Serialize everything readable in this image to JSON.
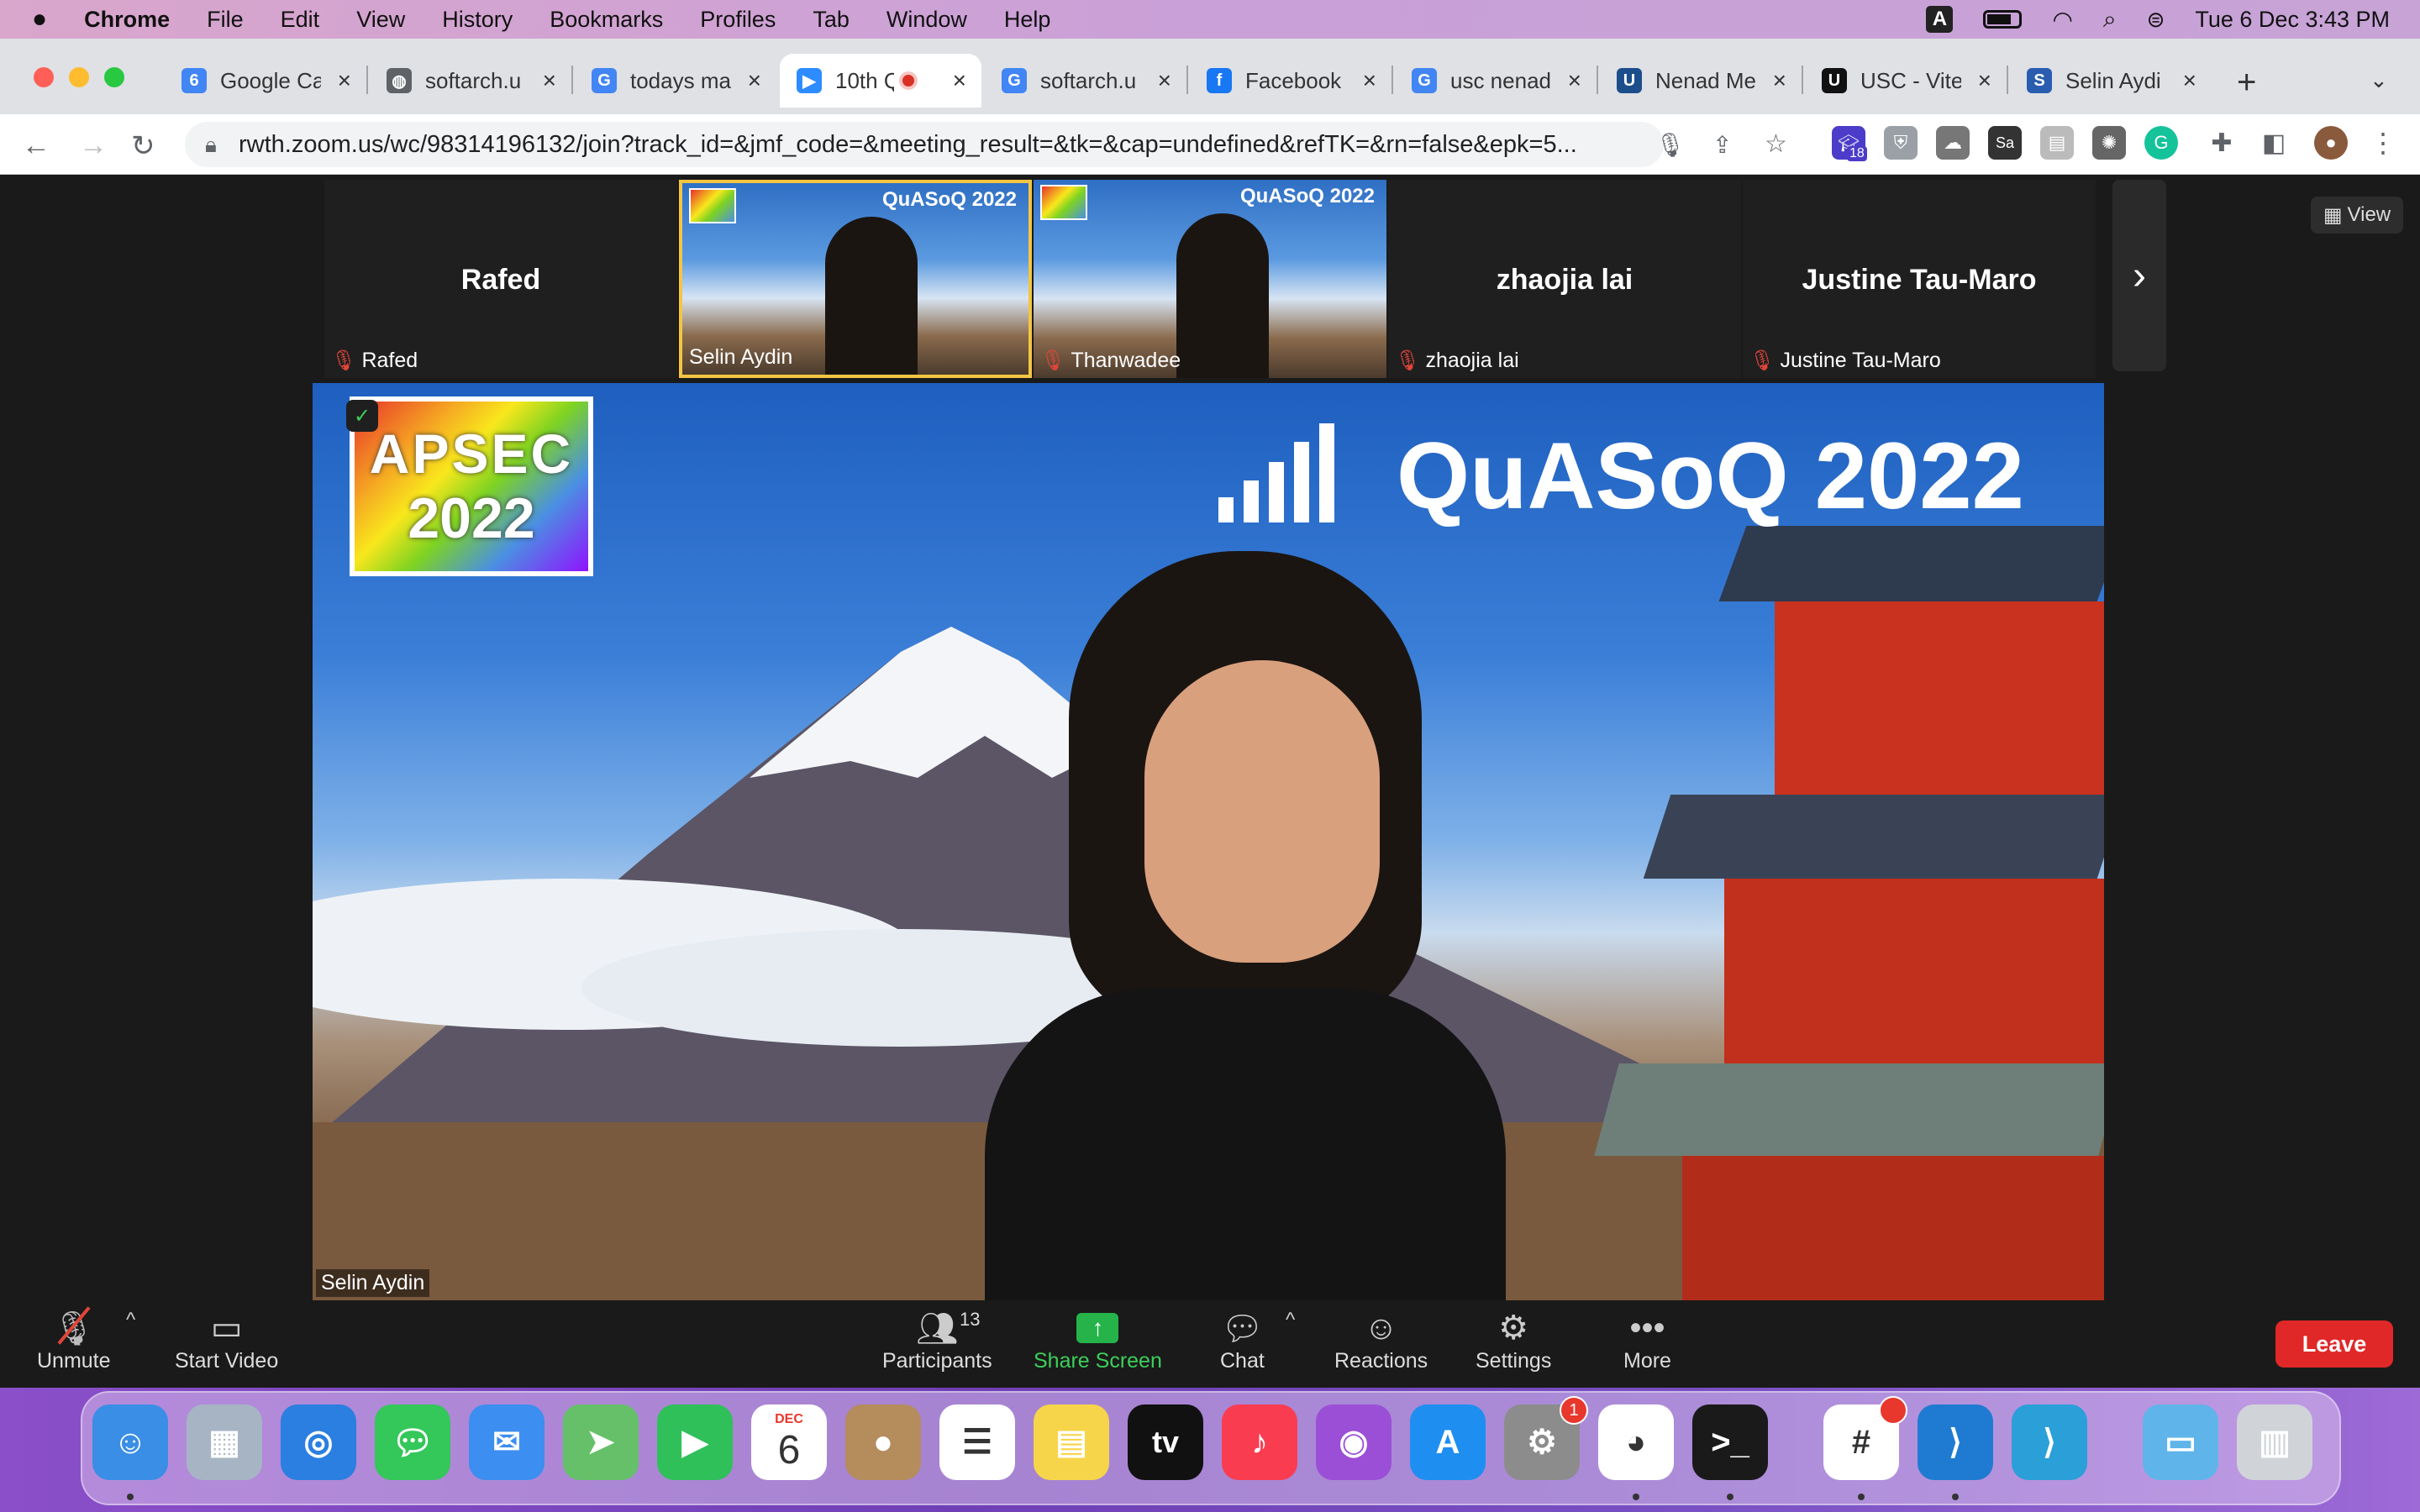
{
  "menubar": {
    "apple_icon": "apple-icon",
    "app": "Chrome",
    "items": [
      "File",
      "Edit",
      "View",
      "History",
      "Bookmarks",
      "Profiles",
      "Tab",
      "Window",
      "Help"
    ],
    "input_source": "A",
    "datetime": "Tue 6 Dec  3:43 PM"
  },
  "tabs": [
    {
      "title": "Google Ca",
      "icon": "google-calendar-icon",
      "fav": "6",
      "color": "#4285f4"
    },
    {
      "title": "softarch.u",
      "icon": "globe-icon",
      "fav": "◍",
      "color": "#5f6368"
    },
    {
      "title": "todays ma",
      "icon": "google-icon",
      "fav": "G",
      "color": "#4285f4"
    },
    {
      "title": "10th Q",
      "icon": "zoom-icon",
      "fav": "▶",
      "color": "#2d8cff",
      "active": true
    },
    {
      "title": "softarch.u",
      "icon": "google-icon",
      "fav": "G",
      "color": "#4285f4"
    },
    {
      "title": "Facebook",
      "icon": "facebook-icon",
      "fav": "f",
      "color": "#1877f2"
    },
    {
      "title": "usc nenad",
      "icon": "google-icon",
      "fav": "G",
      "color": "#4285f4"
    },
    {
      "title": "Nenad Me",
      "icon": "uci-icon",
      "fav": "U",
      "color": "#1c4e8c"
    },
    {
      "title": "USC - Vite",
      "icon": "usc-icon",
      "fav": "U",
      "color": "#111111"
    },
    {
      "title": "Selin Aydi",
      "icon": "sue-icon",
      "fav": "S",
      "color": "#2a5db0"
    }
  ],
  "toolbar": {
    "url": "rwth.zoom.us/wc/98314196132/join?track_id=&jmf_code=&meeting_result=&tk=&cap=undefined&refTK=&rn=false&epk=5...",
    "ext_badge": "18"
  },
  "zoom": {
    "view_label": "View",
    "thumbs": [
      {
        "name": "Rafed",
        "label": "Rafed",
        "muted": true,
        "video": false
      },
      {
        "name": "",
        "label": "Selin Aydin",
        "muted": false,
        "video": true,
        "banner": "QuASoQ 2022"
      },
      {
        "name": "",
        "label": "Thanwadee",
        "muted": true,
        "video": true,
        "banner": "QuASoQ 2022"
      },
      {
        "name": "zhaojia lai",
        "label": "zhaojia lai",
        "muted": true,
        "video": false
      },
      {
        "name": "Justine Tau-Maro",
        "label": "Justine Tau-Maro",
        "muted": true,
        "video": false
      }
    ],
    "main": {
      "speaker": "Selin Aydin",
      "banner": "QuASoQ 2022",
      "logo_line1": "APSEC",
      "logo_line2": "2022"
    },
    "controls": {
      "unmute": "Unmute",
      "start_video": "Start Video",
      "participants": "Participants",
      "participants_count": "13",
      "share_screen": "Share Screen",
      "chat": "Chat",
      "reactions": "Reactions",
      "settings": "Settings",
      "more": "More",
      "leave": "Leave"
    }
  },
  "dock": {
    "calendar_month": "DEC",
    "calendar_day": "6",
    "settings_badge": "1",
    "tv_label": "tv",
    "apps": [
      "finder",
      "launchpad",
      "safari",
      "messages",
      "mail",
      "maps",
      "facetime",
      "calendar",
      "contacts",
      "reminders",
      "notes",
      "tv",
      "music",
      "podcasts",
      "app-store",
      "system-preferences",
      "chrome",
      "terminal",
      "slack",
      "vscode",
      "vscode-insiders",
      "folder",
      "trash"
    ]
  }
}
